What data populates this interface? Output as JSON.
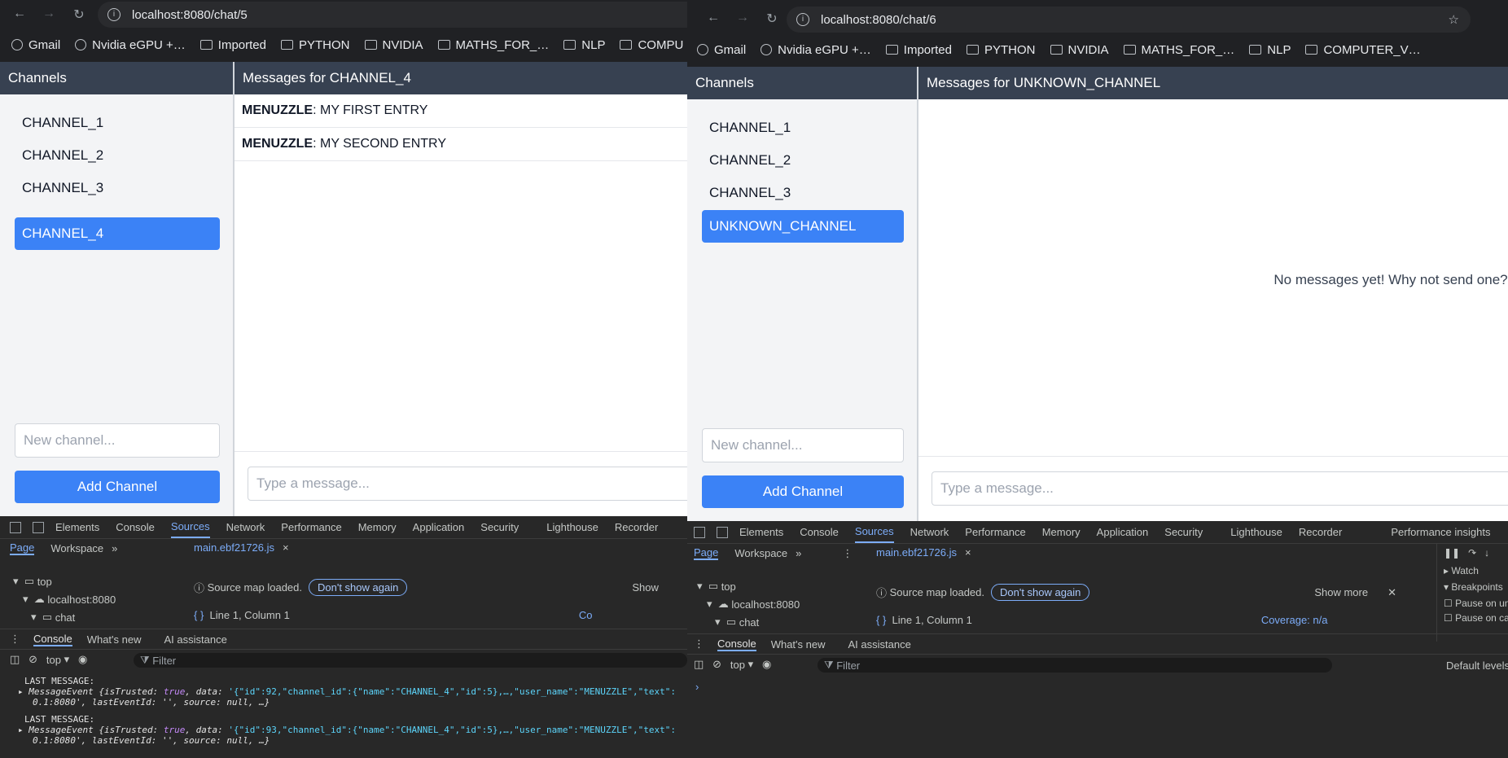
{
  "left": {
    "url": "localhost:8080/chat/5",
    "bookmarks": [
      "Gmail",
      "Nvidia eGPU +…",
      "Imported",
      "PYTHON",
      "NVIDIA",
      "MATHS_FOR_…",
      "NLP",
      "COMPU"
    ],
    "sidebar_title": "Channels",
    "channels": [
      "CHANNEL_1",
      "CHANNEL_2",
      "CHANNEL_3",
      "CHANNEL_4"
    ],
    "active_channel": "CHANNEL_4",
    "new_channel_placeholder": "New channel...",
    "add_channel_label": "Add Channel",
    "messages_title": "Messages for CHANNEL_4",
    "messages": [
      {
        "user": "MENUZZLE",
        "text": ": MY FIRST ENTRY"
      },
      {
        "user": "MENUZZLE",
        "text": ": MY SECOND ENTRY"
      }
    ],
    "message_placeholder": "Type a message...",
    "devtools": {
      "tabs": [
        "Elements",
        "Console",
        "Sources",
        "Network",
        "Performance",
        "Memory",
        "Application",
        "Security",
        "Lighthouse",
        "Recorder"
      ],
      "selected_tab": "Sources",
      "nav_tabs": [
        "Page",
        "Workspace"
      ],
      "file_tab": "main.ebf21726.js",
      "tree": [
        "top",
        "localhost:8080",
        "chat"
      ],
      "sourcemap_msg": "Source map loaded.",
      "dont_show": "Don't show again",
      "show_more": "Show",
      "position": "Line 1, Column 1",
      "coverage": "Co",
      "drawer_tabs": [
        "Console",
        "What's new",
        "AI assistance"
      ],
      "context": "top",
      "filter": "Filter",
      "log": [
        {
          "label": "LAST MESSAGE:",
          "line1_a": "MessageEvent {",
          "line1_b": "isTrusted: ",
          "line1_c": "true",
          "line1_d": ", data: ",
          "line1_e": "'{\"id\":92,\"channel_id\":{\"name\":\"CHANNEL_4\",\"id\":5},…,\"user_name\":\"MENUZZLE\",\"text\":",
          "line2": "0.1:8080', lastEventId: '', source: null, …}"
        },
        {
          "label": "LAST MESSAGE:",
          "line1_a": "MessageEvent {",
          "line1_b": "isTrusted: ",
          "line1_c": "true",
          "line1_d": ", data: ",
          "line1_e": "'{\"id\":93,\"channel_id\":{\"name\":\"CHANNEL_4\",\"id\":5},…,\"user_name\":\"MENUZZLE\",\"text\":",
          "line2": "0.1:8080', lastEventId: '', source: null, …}"
        }
      ]
    }
  },
  "right": {
    "url": "localhost:8080/chat/6",
    "bookmarks": [
      "Gmail",
      "Nvidia eGPU +…",
      "Imported",
      "PYTHON",
      "NVIDIA",
      "MATHS_FOR_…",
      "NLP",
      "COMPUTER_V…"
    ],
    "sidebar_title": "Channels",
    "channels": [
      "CHANNEL_1",
      "CHANNEL_2",
      "CHANNEL_3",
      "UNKNOWN_CHANNEL"
    ],
    "active_channel": "UNKNOWN_CHANNEL",
    "new_channel_placeholder": "New channel...",
    "add_channel_label": "Add Channel",
    "messages_title": "Messages for UNKNOWN_CHANNEL",
    "empty_text": "No messages yet! Why not send one?",
    "message_placeholder": "Type a message...",
    "devtools": {
      "tabs": [
        "Elements",
        "Console",
        "Sources",
        "Network",
        "Performance",
        "Memory",
        "Application",
        "Security",
        "Lighthouse",
        "Recorder",
        "Performance insights"
      ],
      "selected_tab": "Sources",
      "nav_tabs": [
        "Page",
        "Workspace"
      ],
      "file_tab": "main.ebf21726.js",
      "tree": [
        "top",
        "localhost:8080",
        "chat"
      ],
      "sourcemap_msg": "Source map loaded.",
      "dont_show": "Don't show again",
      "show_more": "Show more",
      "position": "Line 1, Column 1",
      "coverage": "Coverage: n/a",
      "side_panel": [
        "Watch",
        "Breakpoints",
        "Pause on un",
        "Pause on ca"
      ],
      "drawer_tabs": [
        "Console",
        "What's new",
        "AI assistance"
      ],
      "context": "top",
      "filter": "Filter",
      "levels": "Default levels"
    }
  }
}
